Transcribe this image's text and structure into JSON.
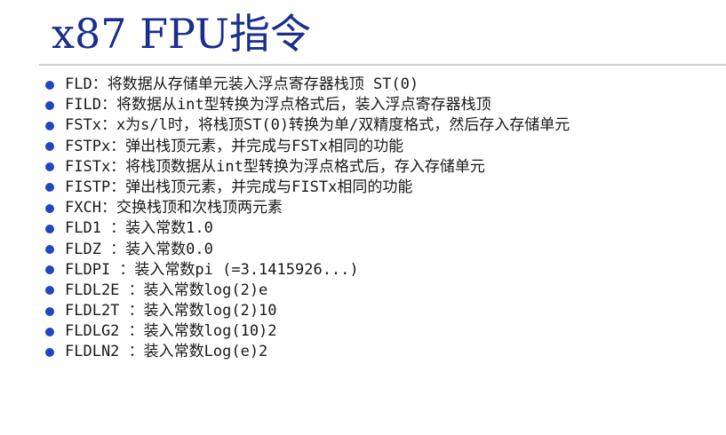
{
  "slide": {
    "title": "x87 FPU指令",
    "accent_color": "#1a2f8c",
    "bullet_color": "#1f46c4",
    "bullet_icon": "bullet-dot-icon",
    "items": [
      "FLD：将数据从存储单元装入浮点寄存器栈顶 ST(0)",
      "FILD：将数据从int型转换为浮点格式后，装入浮点寄存器栈顶",
      "FSTx：x为s/l时，将栈顶ST(0)转换为单/双精度格式，然后存入存储单元",
      "FSTPx：弹出栈顶元素，并完成与FSTx相同的功能",
      "FISTx：将栈顶数据从int型转换为浮点格式后，存入存储单元",
      "FISTP：弹出栈顶元素，并完成与FISTx相同的功能",
      "FXCH：交换栈顶和次栈顶两元素",
      "FLD1 ：装入常数1.0",
      "FLDZ ：装入常数0.0",
      "FLDPI ：装入常数pi (=3.1415926...)",
      "FLDL2E ：装入常数log(2)e",
      "FLDL2T ：装入常数log(2)10",
      "FLDLG2 ：装入常数log(10)2",
      "FLDLN2 ：装入常数Log(e)2"
    ]
  }
}
